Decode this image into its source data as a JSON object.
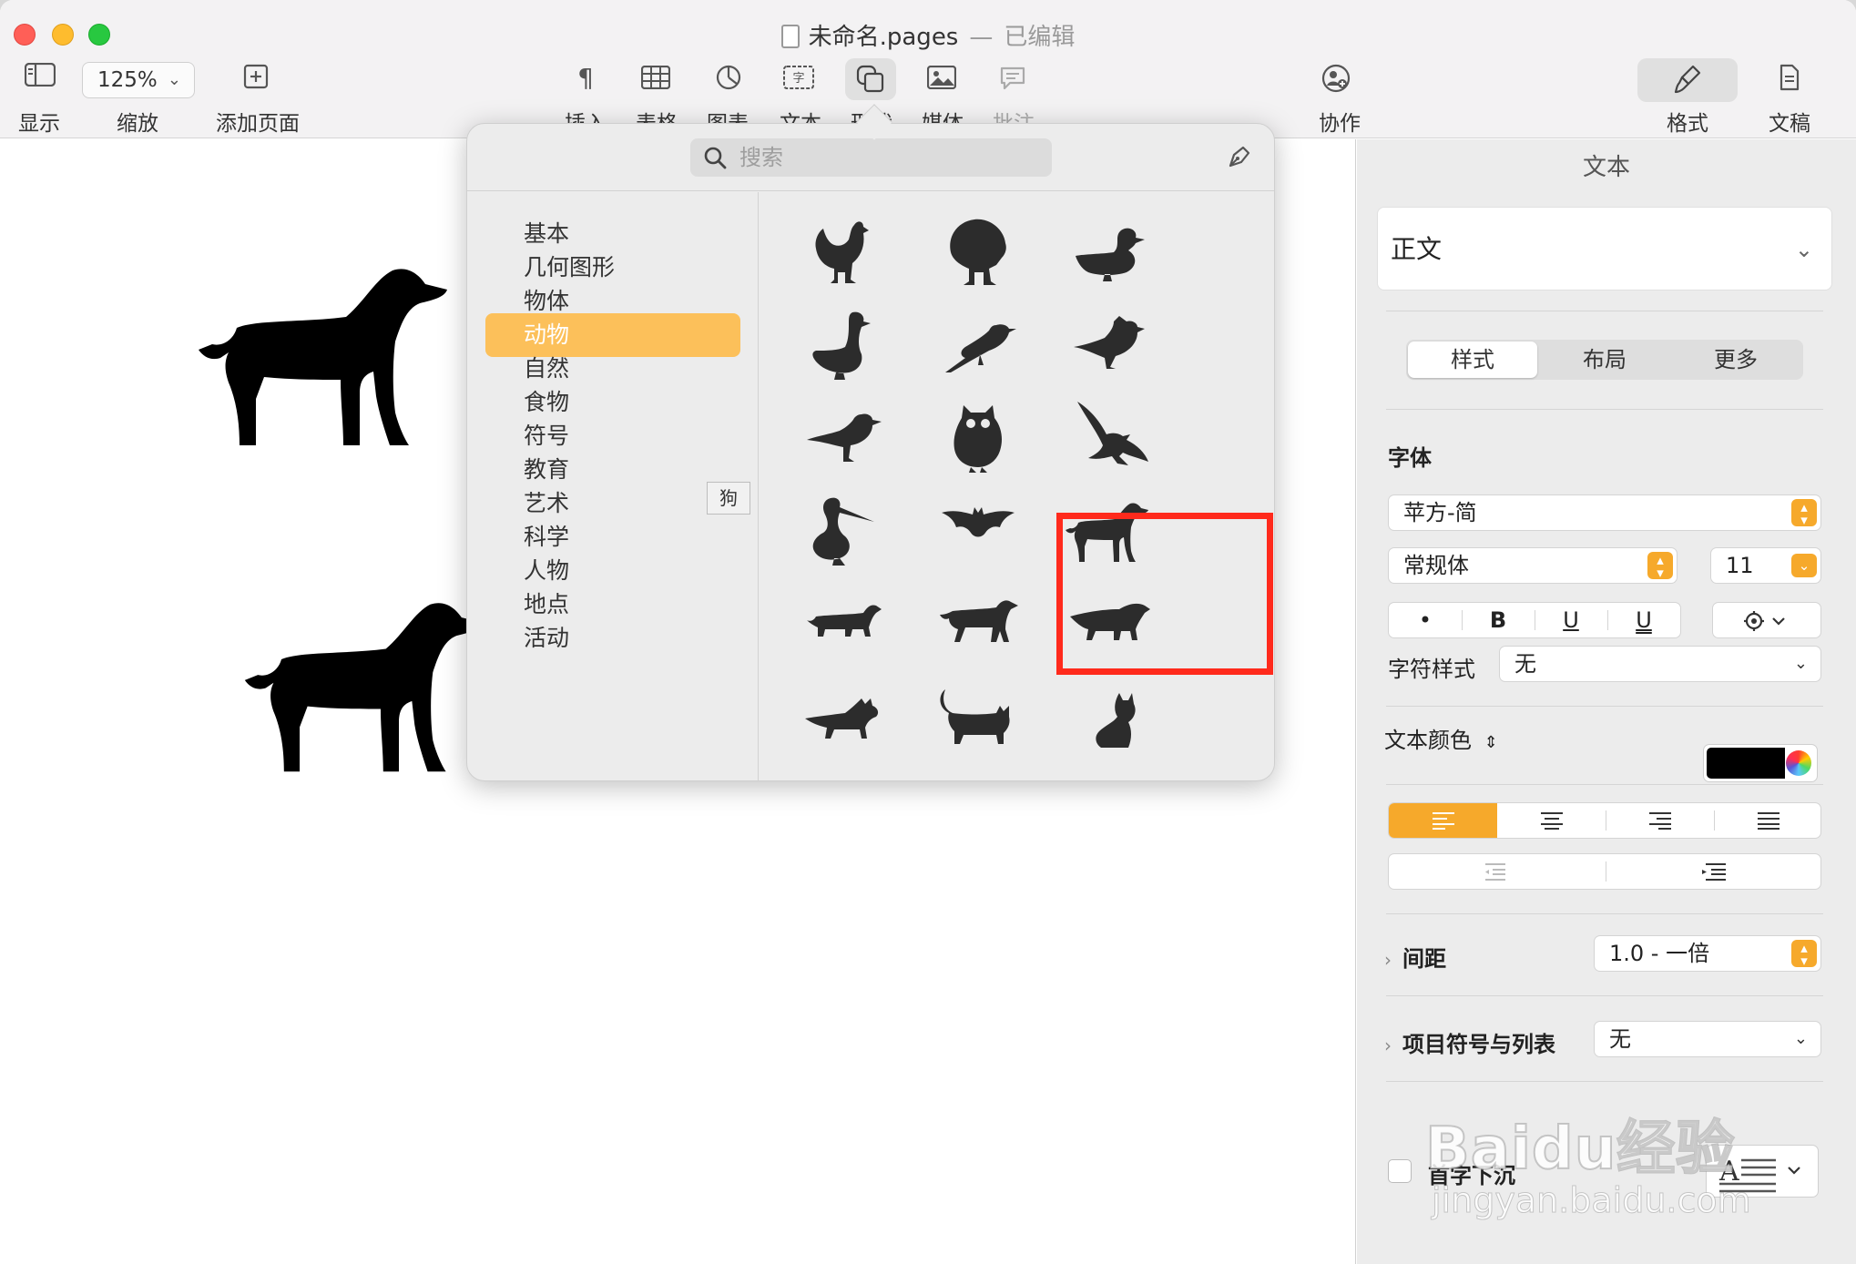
{
  "window": {
    "title": "未命名.pages",
    "separator": "—",
    "status": "已编辑"
  },
  "toolbar": {
    "view_label": "显示",
    "zoom_value": "125%",
    "zoom_label": "缩放",
    "add_page_label": "添加页面",
    "insert_label": "插入",
    "table_label": "表格",
    "chart_label": "图表",
    "text_label": "文本",
    "shape_label": "形状",
    "media_label": "媒体",
    "comment_label": "批注",
    "collaborate_label": "协作",
    "format_label": "格式",
    "document_label": "文稿"
  },
  "shape_popover": {
    "search_placeholder": "搜索",
    "categories": [
      "基本",
      "几何图形",
      "物体",
      "动物",
      "自然",
      "食物",
      "符号",
      "教育",
      "艺术",
      "科学",
      "人物",
      "地点",
      "活动"
    ],
    "selected_category": "动物",
    "shapes": [
      "rooster",
      "turkey",
      "duck",
      "goose",
      "magpie",
      "cardinal",
      "crow",
      "owl",
      "eagle",
      "pelican",
      "bat",
      "dog",
      "dachshund",
      "hound",
      "wolf",
      "fox",
      "cat",
      "sitting-cat"
    ],
    "tooltip": "狗"
  },
  "inspector": {
    "title": "文本",
    "paragraph_style": "正文",
    "tabs": [
      "样式",
      "布局",
      "更多"
    ],
    "active_tab": "样式",
    "font_section": "字体",
    "font_family": "苹方-简",
    "font_weight": "常规体",
    "font_size": "11",
    "format_buttons": [
      "•",
      "B",
      "U",
      "U"
    ],
    "char_style_label": "字符样式",
    "char_style_value": "无",
    "text_color_label": "文本颜色",
    "text_color": "#000000",
    "spacing_label": "间距",
    "spacing_value": "1.0 - 一倍",
    "bullets_label": "项目符号与列表",
    "bullets_value": "无",
    "dropcap_label": "首字下沉"
  },
  "watermark": {
    "line1": "Baidu经验",
    "line2": "jingyan.baidu.com"
  },
  "colors": {
    "accent": "#f6a92b",
    "selected_category_bg": "#fcc05a",
    "highlight_box": "#ff2a1c"
  }
}
